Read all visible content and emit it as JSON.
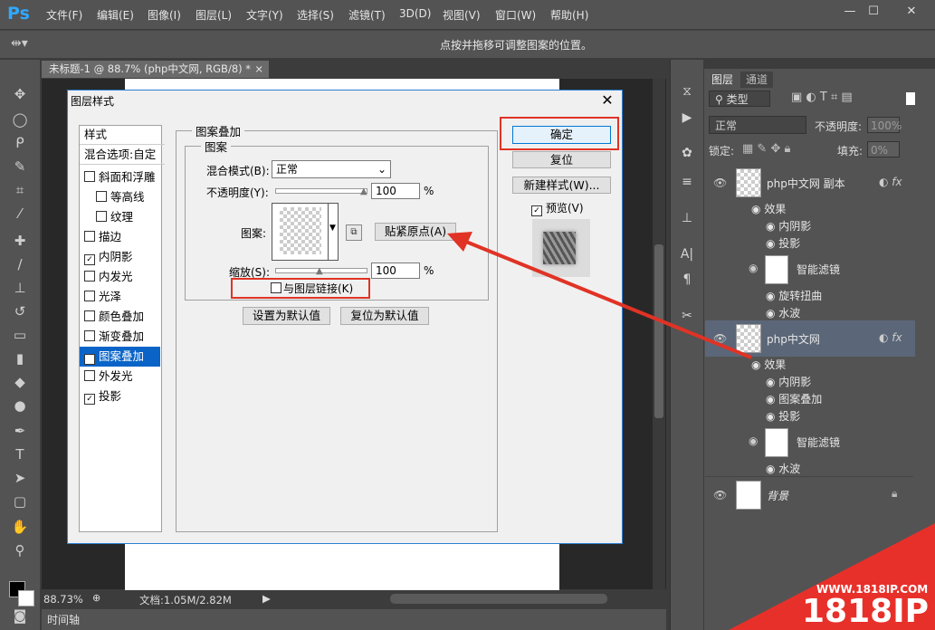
{
  "app": {
    "logo": "Ps",
    "menu": [
      "文件(F)",
      "编辑(E)",
      "图像(I)",
      "图层(L)",
      "文字(Y)",
      "选择(S)",
      "滤镜(T)",
      "3D(D)",
      "视图(V)",
      "窗口(W)",
      "帮助(H)"
    ],
    "window_controls": {
      "minimize": "—",
      "maximize": "☐",
      "close": "✕"
    }
  },
  "options_bar": {
    "hint": "点按并拖移可调整图案的位置。"
  },
  "document": {
    "tab_title": "未标题-1 @ 88.7% (php中文网, RGB/8) *",
    "tab_close": "×",
    "zoom": "88.73%",
    "doc_size": "文档:1.05M/2.82M",
    "timeline_label": "时间轴"
  },
  "layers_panel": {
    "tabs": [
      "图层",
      "通道"
    ],
    "filter_kind": "类型",
    "blend_mode": "正常",
    "opacity_label": "不透明度:",
    "opacity_value": "100%",
    "lock_label": "锁定:",
    "fill_label": "填充:",
    "fill_value": "0%",
    "layers": [
      {
        "name": "php中文网 副本",
        "effects_label": "效果",
        "effects": [
          "内阴影",
          "投影"
        ],
        "smart_filters_label": "智能滤镜",
        "smart_filters": [
          "旋转扭曲",
          "水波"
        ]
      },
      {
        "name": "php中文网",
        "effects_label": "效果",
        "effects": [
          "内阴影",
          "图案叠加",
          "投影"
        ],
        "smart_filters_label": "智能滤镜",
        "smart_filters": [
          "水波"
        ]
      },
      {
        "name": "背景"
      }
    ]
  },
  "dialog": {
    "title": "图层样式",
    "styles_header": "样式",
    "blend_options": "混合选项:自定",
    "style_items": [
      {
        "label": "斜面和浮雕",
        "checked": false,
        "indent": false
      },
      {
        "label": "等高线",
        "checked": false,
        "indent": true
      },
      {
        "label": "纹理",
        "checked": false,
        "indent": true
      },
      {
        "label": "描边",
        "checked": false,
        "indent": false
      },
      {
        "label": "内阴影",
        "checked": true,
        "indent": false
      },
      {
        "label": "内发光",
        "checked": false,
        "indent": false
      },
      {
        "label": "光泽",
        "checked": false,
        "indent": false
      },
      {
        "label": "颜色叠加",
        "checked": false,
        "indent": false
      },
      {
        "label": "渐变叠加",
        "checked": false,
        "indent": false
      },
      {
        "label": "图案叠加",
        "checked": true,
        "indent": false,
        "selected": true
      },
      {
        "label": "外发光",
        "checked": false,
        "indent": false
      },
      {
        "label": "投影",
        "checked": true,
        "indent": false
      }
    ],
    "section_title": "图案叠加",
    "subsection_title": "图案",
    "blend_mode_label": "混合模式(B):",
    "blend_mode_value": "正常",
    "opacity_label": "不透明度(Y):",
    "opacity_value": "100",
    "opacity_fraction": 1.0,
    "percent": "%",
    "pattern_label": "图案:",
    "snap_origin_button": "贴紧原点(A)",
    "scale_label": "缩放(S):",
    "scale_value": "100",
    "scale_fraction": 0.5,
    "link_with_layer_label": "与图层链接(K)",
    "set_default_button": "设置为默认值",
    "reset_default_button": "复位为默认值",
    "ok_button": "确定",
    "reset_button": "复位",
    "new_style_button": "新建样式(W)...",
    "preview_label": "预览(V)"
  },
  "colors": {
    "highlight_red": "#e03325",
    "selected_blue": "#0a64c8"
  },
  "watermark": {
    "url": "WWW.1818IP.COM",
    "brand": "1818IP"
  }
}
